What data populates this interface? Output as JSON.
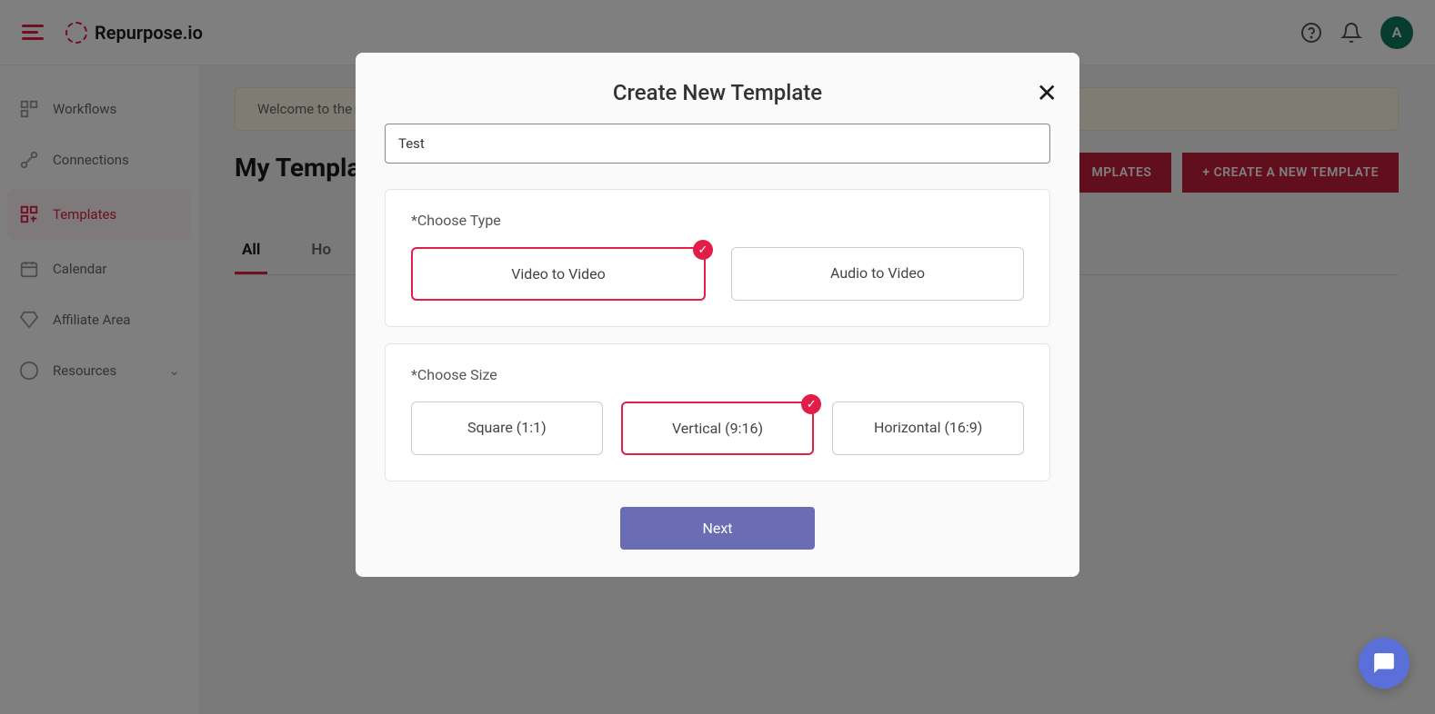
{
  "header": {
    "logo_text": "Repurpose.io",
    "avatar_initial": "A"
  },
  "sidebar": {
    "items": [
      {
        "label": "Workflows"
      },
      {
        "label": "Connections"
      },
      {
        "label": "Templates"
      },
      {
        "label": "Calendar"
      },
      {
        "label": "Affiliate Area"
      },
      {
        "label": "Resources"
      }
    ]
  },
  "main": {
    "banner_text": "Welcome to the",
    "page_title": "My Templa",
    "button_templates": "MPLATES",
    "button_create": "+ CREATE A NEW TEMPLATE",
    "tabs": [
      {
        "label": "All"
      },
      {
        "label": "Ho"
      }
    ]
  },
  "modal": {
    "title": "Create New Template",
    "input_value": "Test",
    "choose_type_label": "*Choose Type",
    "type_options": [
      {
        "label": "Video to Video",
        "selected": true
      },
      {
        "label": "Audio to Video",
        "selected": false
      }
    ],
    "choose_size_label": "*Choose Size",
    "size_options": [
      {
        "label": "Square (1:1)",
        "selected": false
      },
      {
        "label": "Vertical (9:16)",
        "selected": true
      },
      {
        "label": "Horizontal (16:9)",
        "selected": false
      }
    ],
    "next_label": "Next"
  }
}
